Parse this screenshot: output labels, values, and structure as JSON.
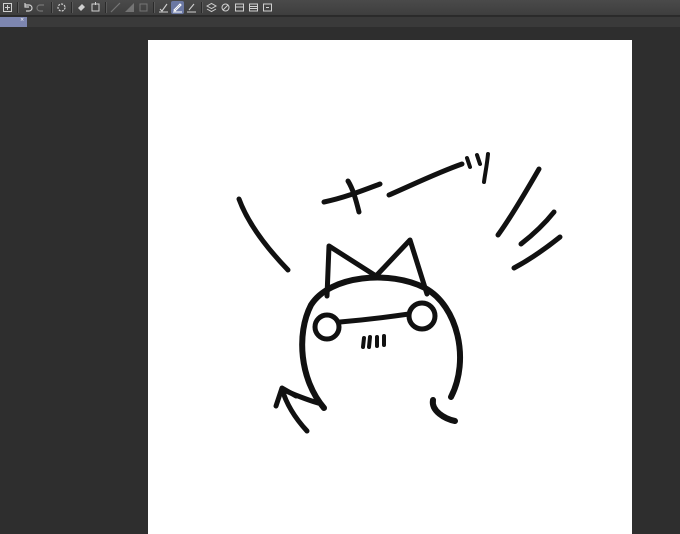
{
  "app": {
    "toolbar": {
      "buttons": [
        {
          "icon": "new-page-icon"
        },
        {
          "icon": "undo-icon"
        },
        {
          "icon": "redo-icon"
        },
        {
          "icon": "loading-icon"
        },
        {
          "icon": "fill-icon"
        },
        {
          "icon": "transform-icon"
        },
        {
          "icon": "snap-ruler-icon"
        },
        {
          "icon": "snap-grid-icon"
        },
        {
          "icon": "snap-special-icon"
        },
        {
          "icon": "selection-check-icon"
        },
        {
          "icon": "selection-pen-check-icon"
        },
        {
          "icon": "selection-pen-icon"
        },
        {
          "icon": "layer-icon"
        },
        {
          "icon": "layer-edit-icon"
        },
        {
          "icon": "layer-mask-icon"
        },
        {
          "icon": "layer-copy-icon"
        },
        {
          "icon": "layer-merge-icon"
        }
      ],
      "active_button": "selection-pen-check-icon"
    },
    "tab": {
      "close_glyph": "×"
    },
    "colors": {
      "toolbar_bg": "#434343",
      "workspace_bg": "#2e2e2e",
      "active_tab": "#7d86b0",
      "canvas_bg": "#ffffff",
      "ink": "#111111"
    }
  }
}
